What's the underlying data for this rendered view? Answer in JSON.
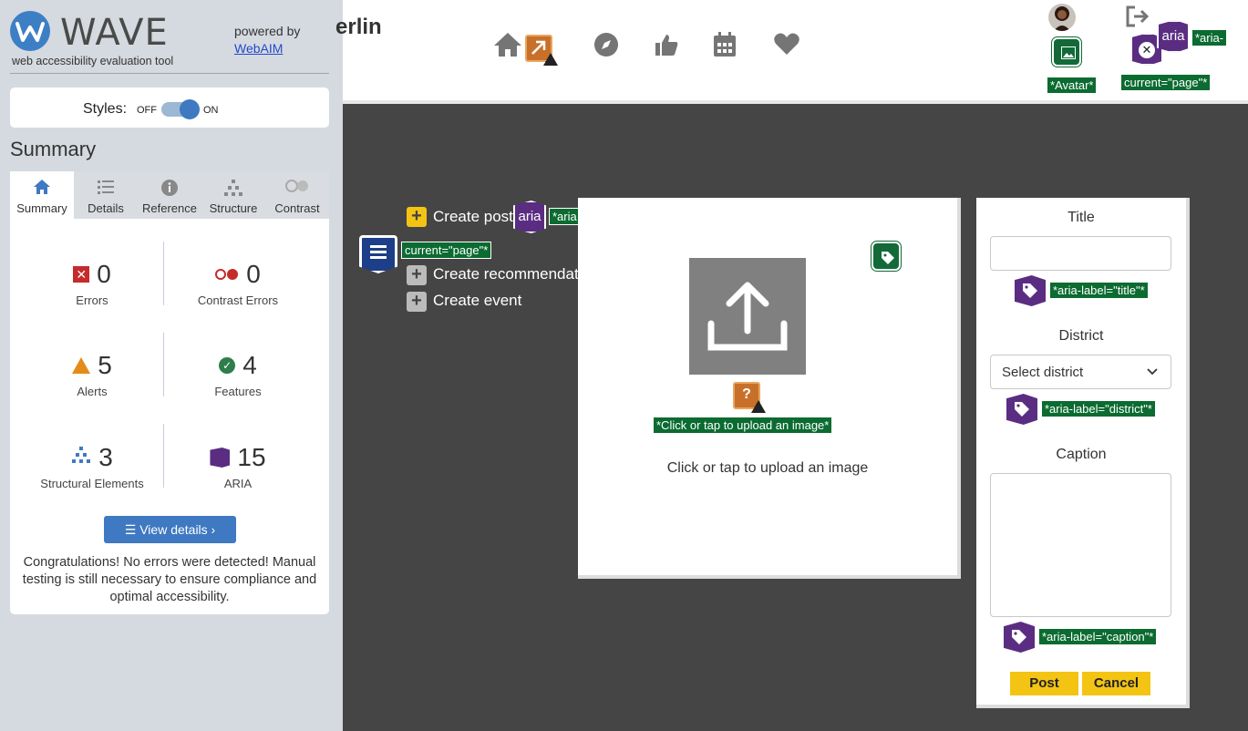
{
  "wave": {
    "title": "WAVE",
    "subtitle": "web accessibility evaluation tool",
    "powered_by": "powered by",
    "webaim_link": "WebAIM",
    "styles_label": "Styles:",
    "styles_off": "OFF",
    "styles_on": "ON",
    "styles_enabled": true,
    "summary_heading": "Summary",
    "tabs": [
      {
        "label": "Summary",
        "icon": "home-icon",
        "active": true
      },
      {
        "label": "Details",
        "icon": "list-icon",
        "active": false
      },
      {
        "label": "Reference",
        "icon": "info-icon",
        "active": false
      },
      {
        "label": "Structure",
        "icon": "hierarchy-icon",
        "active": false
      },
      {
        "label": "Contrast",
        "icon": "contrast-icon",
        "active": false
      }
    ],
    "stats": {
      "errors": {
        "value": "0",
        "label": "Errors"
      },
      "contrast_errors": {
        "value": "0",
        "label": "Contrast Errors"
      },
      "alerts": {
        "value": "5",
        "label": "Alerts"
      },
      "features": {
        "value": "4",
        "label": "Features"
      },
      "structural": {
        "value": "3",
        "label": "Structural Elements"
      },
      "aria": {
        "value": "15",
        "label": "ARIA"
      }
    },
    "view_details": "View details ›",
    "congrats": "Congratulations! No errors were detected! Manual testing is still necessary to ensure compliance and optimal accessibility.",
    "colors": {
      "accent": "#3f79c1",
      "error": "#c62b2b",
      "alert": "#e38c1b",
      "feature": "#2f7d4c",
      "aria": "#5a2d82"
    }
  },
  "page": {
    "brand": "erlin",
    "nav_icons": [
      "home-icon",
      "compass-icon",
      "thumbs-up-icon",
      "calendar-icon",
      "heart-icon"
    ],
    "avatar_tag": "*Avatar*",
    "aria_current_tag": "current=\"page\"*",
    "aria_label_tag_top": "*aria-",
    "aria_badge_text": "aria",
    "menu": [
      {
        "label": "Create post",
        "icon": "plus-icon",
        "active": true
      },
      {
        "label": "Create recommendati",
        "icon": "plus-icon",
        "active": false
      },
      {
        "label": "Create event",
        "icon": "plus-icon",
        "active": false
      }
    ],
    "menu_aria_tag": "*aria",
    "menu_current_tag": "current=\"page\"*",
    "upload": {
      "alt_tag": "*Click or tap to upload an image*",
      "caption": "Click or tap to upload an image"
    },
    "form": {
      "title_label": "Title",
      "title_value": "",
      "title_aria_tag": "*aria-label=\"title\"*",
      "district_label": "District",
      "district_value": "Select district",
      "district_aria_tag": "*aria-label=\"district\"*",
      "caption_label": "Caption",
      "caption_value": "",
      "caption_aria_tag": "*aria-label=\"caption\"*",
      "post_button": "Post",
      "cancel_button": "Cancel"
    },
    "colors": {
      "background": "#454545",
      "button": "#f3c413",
      "wave_tag": "#0b6b31"
    }
  }
}
